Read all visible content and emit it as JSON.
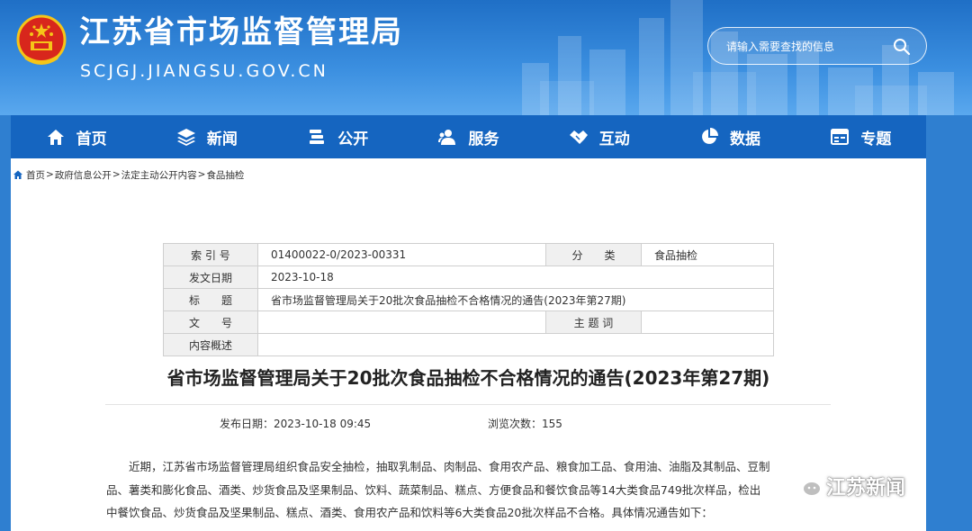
{
  "header": {
    "site_title": "江苏省市场监督管理局",
    "site_domain": "SCJGJ.JIANGSU.GOV.CN",
    "search": {
      "placeholder": "请输入需要查找的信息"
    }
  },
  "nav": {
    "items": [
      {
        "label": "首页",
        "icon": "home-icon"
      },
      {
        "label": "新闻",
        "icon": "layers-icon"
      },
      {
        "label": "公开",
        "icon": "stack-icon"
      },
      {
        "label": "服务",
        "icon": "users-icon"
      },
      {
        "label": "互动",
        "icon": "handshake-icon"
      },
      {
        "label": "数据",
        "icon": "pie-chart-icon"
      },
      {
        "label": "专题",
        "icon": "calendar-icon"
      }
    ]
  },
  "breadcrumb": [
    "首页",
    "政府信息公开",
    "法定主动公开内容",
    "食品抽检"
  ],
  "meta": {
    "index_label": "索 引 号",
    "index_value": "01400022-0/2023-00331",
    "category_label": "分　　类",
    "category_value": "食品抽检",
    "date_label": "发文日期",
    "date_value": "2023-10-18",
    "title_label": "标　　题",
    "title_value": "省市场监督管理局关于20批次食品抽检不合格情况的通告(2023年第27期)",
    "docno_label": "文　　号",
    "docno_value": "",
    "keywords_label": "主 题 词",
    "keywords_value": "",
    "summary_label": "内容概述",
    "summary_value": ""
  },
  "article": {
    "title": "省市场监督管理局关于20批次食品抽检不合格情况的通告(2023年第27期)",
    "publish_label": "发布日期：",
    "publish_value": "2023-10-18 09:45",
    "views_label": "浏览次数：",
    "views_value": "155",
    "body_line1": "近期，江苏省市场监督管理局组织食品安全抽检，抽取乳制品、肉制品、食用农产品、粮食加工品、食用油、油脂及其制品、豆制",
    "body_line2": "品、薯类和膨化食品、酒类、炒货食品及坚果制品、饮料、蔬菜制品、糕点、方便食品和餐饮食品等14大类食品749批次样品，检出",
    "body_line3": "中餐饮食品、炒货食品及坚果制品、糕点、酒类、食用农产品和饮料等6大类食品20批次样品不合格。具体情况通告如下："
  },
  "watermark": {
    "text": "江苏新闻"
  },
  "colors": {
    "nav_bg": "#1565c0",
    "header_bg": "#2f7fd0"
  }
}
